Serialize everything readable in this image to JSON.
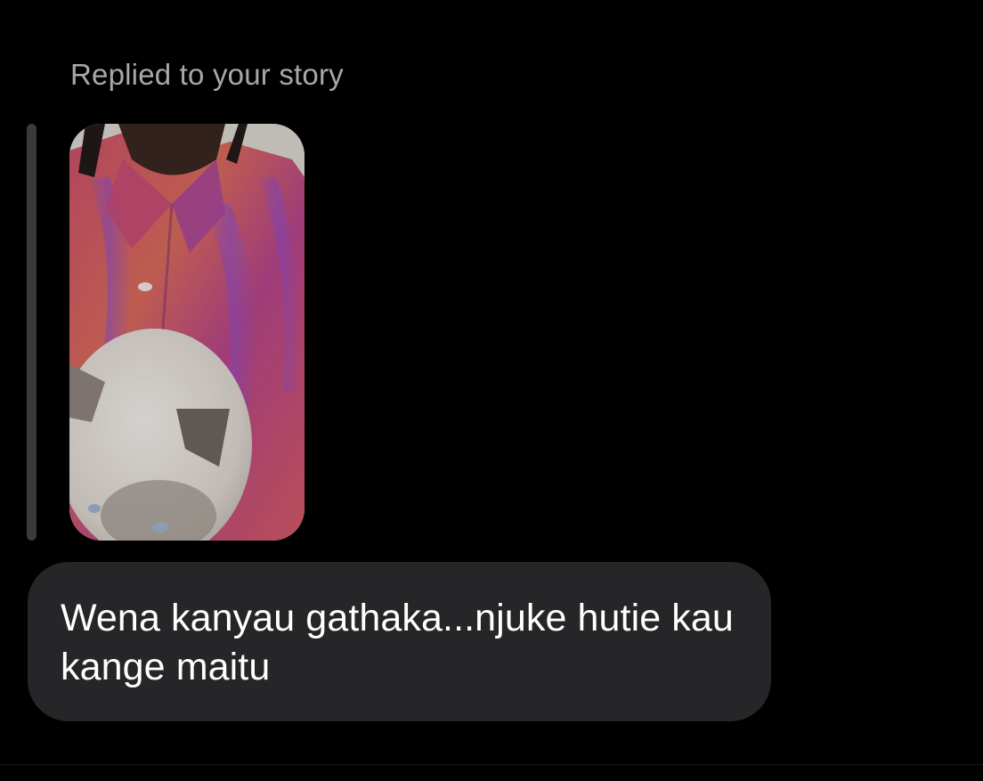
{
  "reply": {
    "label": "Replied to your story"
  },
  "story": {
    "icon": "story-photo-person-with-cat"
  },
  "message": {
    "text": "Wena kanyau gathaka...njuke hutie kau kange maitu"
  },
  "colors": {
    "background": "#000000",
    "bubble": "#262628",
    "label": "#a8a8a8",
    "reply_bar": "#3a3a3c",
    "message_text": "#ffffff"
  }
}
